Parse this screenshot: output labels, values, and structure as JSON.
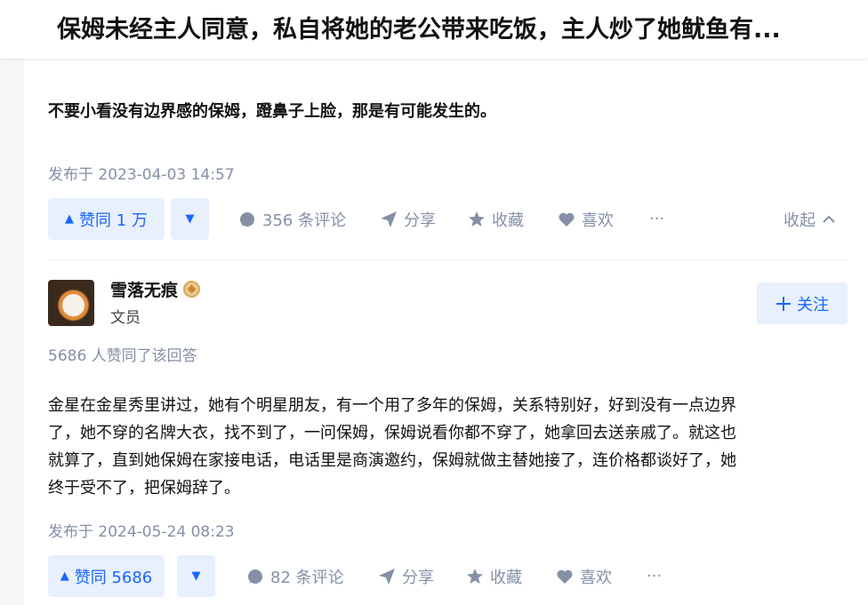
{
  "header": {
    "question_title": "保姆未经主人同意，私自将她的老公带来吃饭，主人炒了她鱿鱼有..."
  },
  "answer1": {
    "text": "不要小看没有边界感的保姆，蹬鼻子上脸，那是有可能发生的。",
    "published": "发布于 2023-04-03 14:57",
    "vote_label": "赞同 1 万",
    "comments_label": "356 条评论",
    "share_label": "分享",
    "favorite_label": "收藏",
    "like_label": "喜欢",
    "more_label": "···",
    "collapse_label": "收起"
  },
  "answer2": {
    "author_name": "雪落无痕",
    "author_title": "文员",
    "follow_label": "关注",
    "vote_summary": "5686 人赞同了该回答",
    "paragraph_lines": [
      "金星在金星秀里讲过，她有个明星朋友，有一个用了多年的保姆，关系特别好，好到没有一点边界",
      "了，她不穿的名牌大衣，找不到了，一问保姆，保姆说看你都不穿了，她拿回去送亲戚了。就这也",
      "就算了，直到她保姆在家接电话，电话里是商演邀约，保姆就做主替她接了，连价格都谈好了，她",
      "终于受不了，把保姆辞了。"
    ],
    "published": "发布于 2024-05-24 08:23",
    "vote_label": "赞同 5686",
    "comments_label": "82 条评论",
    "share_label": "分享",
    "favorite_label": "收藏",
    "like_label": "喜欢",
    "more_label": "···"
  },
  "colors": {
    "accent": "#1966ff",
    "accent_bg": "#e8f0fd",
    "muted": "#8590a6"
  }
}
